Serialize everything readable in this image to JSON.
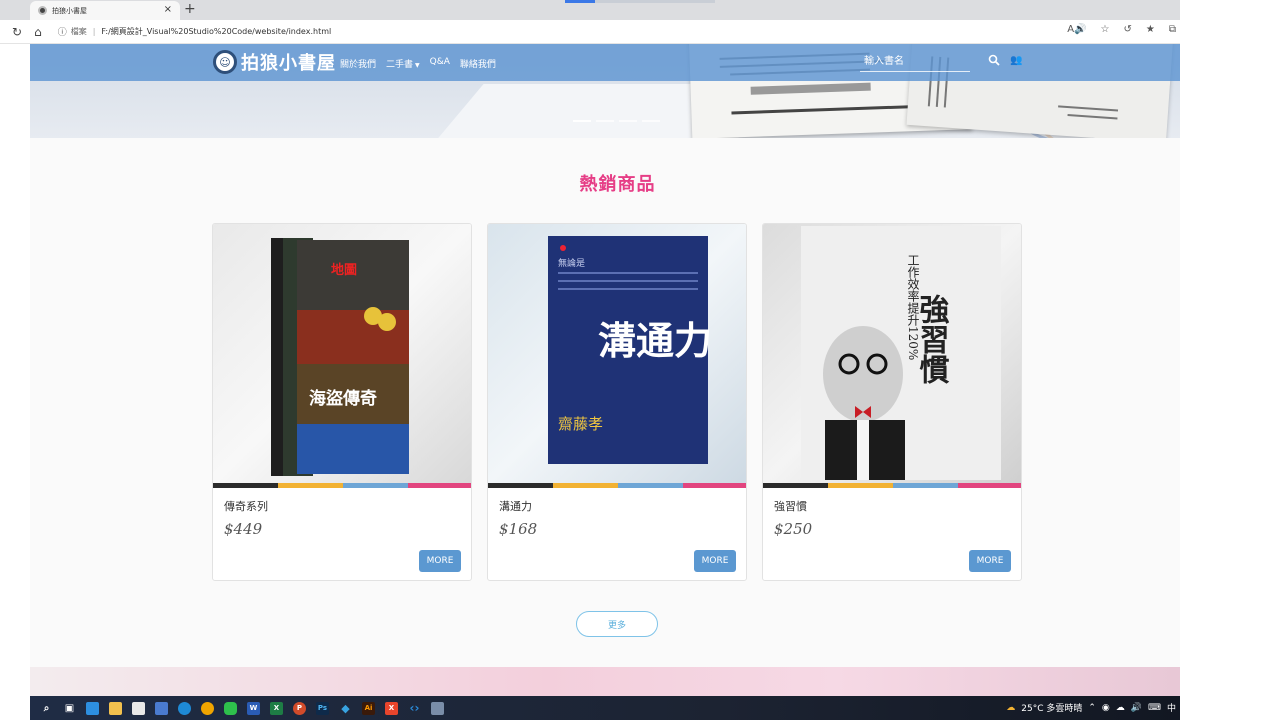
{
  "browser": {
    "tab_title": "拍狼小書屋",
    "tab_close": "×",
    "new_tab": "+",
    "address_label": "檔案",
    "url": "F:/網頁設計_Visual%20Studio%20Code/website/index.html"
  },
  "site": {
    "logo_text": "拍狼小書屋",
    "nav": {
      "about": "關於我們",
      "secondhand": "二手書",
      "qa": "Q&A",
      "contact": "聯絡我們"
    },
    "search_placeholder": "輸入書名",
    "section_title": "熱銷商品",
    "products": [
      {
        "name": "傳奇系列",
        "price": "$449",
        "more": "MORE"
      },
      {
        "name": "溝通力",
        "price": "$168",
        "more": "MORE"
      },
      {
        "name": "強習慣",
        "price": "$250",
        "more": "MORE"
      }
    ],
    "more_link": "更多",
    "stripe_colors": [
      "#2b2b2b",
      "#f2b233",
      "#6ea6d6",
      "#e2457f"
    ]
  },
  "book_covers": {
    "book1_title": "海盜傳奇",
    "book2_title": "溝通力",
    "book2_author": "齋藤孝",
    "book3_title": "強習慣",
    "book3_subtitle": "工作效率提升120%"
  },
  "taskbar": {
    "weather": "25°C 多雲時晴",
    "ime": "中"
  }
}
